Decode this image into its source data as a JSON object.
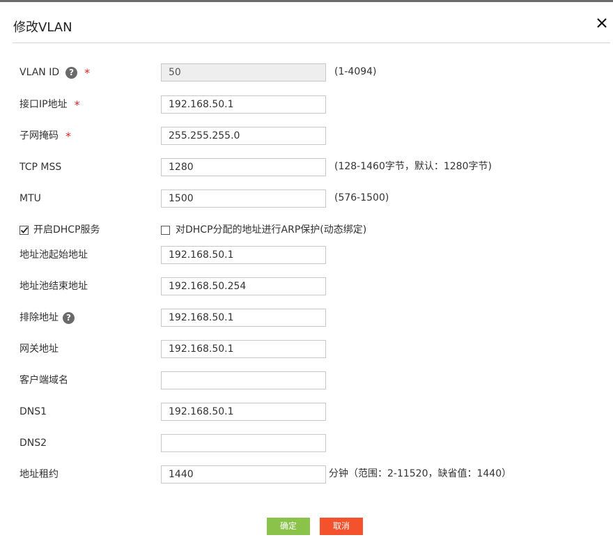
{
  "dialog": {
    "title": "修改VLAN",
    "close_icon": "close-icon"
  },
  "fields": {
    "vlan_id": {
      "label": "VLAN ID",
      "value": "50",
      "hint": "(1-4094)",
      "required": "*"
    },
    "interface_ip": {
      "label": "接口IP地址",
      "value": "192.168.50.1",
      "required": "*"
    },
    "subnet_mask": {
      "label": "子网掩码",
      "value": "255.255.255.0",
      "required": "*"
    },
    "tcp_mss": {
      "label": "TCP MSS",
      "value": "1280",
      "hint": "(128-1460字节，默认：1280字节)"
    },
    "mtu": {
      "label": "MTU",
      "value": "1500",
      "hint": "(576-1500)"
    },
    "dhcp": {
      "label": "开启DHCP服务",
      "checked": true
    },
    "arp_protect": {
      "label": "对DHCP分配的地址进行ARP保护(动态绑定)",
      "checked": false
    },
    "pool_start": {
      "label": "地址池起始地址",
      "value": "192.168.50.1"
    },
    "pool_end": {
      "label": "地址池结束地址",
      "value": "192.168.50.254"
    },
    "exclude": {
      "label": "排除地址",
      "value": "192.168.50.1"
    },
    "gateway": {
      "label": "网关地址",
      "value": "192.168.50.1"
    },
    "client_domain": {
      "label": "客户端域名",
      "value": ""
    },
    "dns1": {
      "label": "DNS1",
      "value": "192.168.50.1"
    },
    "dns2": {
      "label": "DNS2",
      "value": ""
    },
    "lease": {
      "label": "地址租约",
      "value": "1440",
      "hint": "分钟（范围：2-11520，缺省值：1440）"
    }
  },
  "help_icon_glyph": "?",
  "buttons": {
    "confirm": "确定",
    "cancel": "取消"
  },
  "colors": {
    "confirm": "#8bc34a",
    "cancel": "#f4522d",
    "required": "#e02020"
  }
}
